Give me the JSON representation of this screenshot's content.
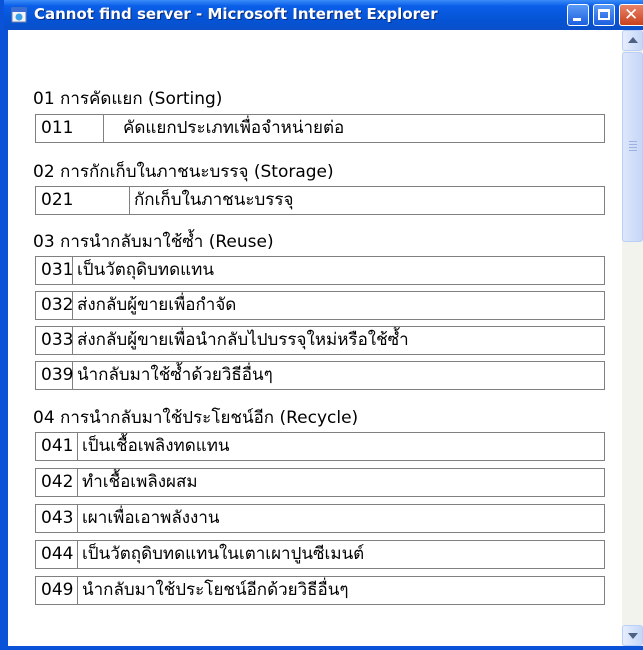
{
  "window": {
    "title": "Cannot find server - Microsoft Internet Explorer",
    "app_icon": "ie-page-icon",
    "controls": [
      "minimize-icon",
      "maximize-icon",
      "close-icon"
    ]
  },
  "sections": [
    {
      "heading": "01 การคัดแยก (Sorting)",
      "items": [
        {
          "code": "011",
          "label": "คัดแยกประเภทเพื่อจำหน่ายต่อ"
        }
      ]
    },
    {
      "heading": "02 การกักเก็บในภาชนะบรรจุ (Storage)",
      "items": [
        {
          "code": "021",
          "label": "กักเก็บในภาชนะบรรจุ"
        }
      ]
    },
    {
      "heading": "03 การนำกลับมาใช้ซ้ำ (Reuse)",
      "items": [
        {
          "code": "031",
          "label": "เป็นวัตถุดิบทดแทน"
        },
        {
          "code": "032",
          "label": "ส่งกลับผู้ขายเพื่อกำจัด"
        },
        {
          "code": "033",
          "label": "ส่งกลับผู้ขายเพื่อนำกลับไปบรรจุใหม่หรือใช้ซ้ำ"
        },
        {
          "code": "039",
          "label": "นำกลับมาใช้ซ้ำด้วยวิธีอื่นๆ"
        }
      ]
    },
    {
      "heading": "04 การนำกลับมาใช้ประโยชน์อีก (Recycle)",
      "items": [
        {
          "code": "041",
          "label": "เป็นเชื้อเพลิงทดแทน"
        },
        {
          "code": "042",
          "label": "ทำเชื้อเพลิงผสม"
        },
        {
          "code": "043",
          "label": "เผาเพื่อเอาพลังงาน"
        },
        {
          "code": "044",
          "label": "เป็นวัตถุดิบทดแทนในเตาเผาปูนซีเมนต์"
        },
        {
          "code": "049",
          "label": "นำกลับมาใช้ประโยชน์อีกด้วยวิธีอื่นๆ"
        }
      ]
    }
  ],
  "scrollbar": {
    "up_icon": "scroll-up-arrow-icon",
    "down_icon": "scroll-down-arrow-icon"
  }
}
